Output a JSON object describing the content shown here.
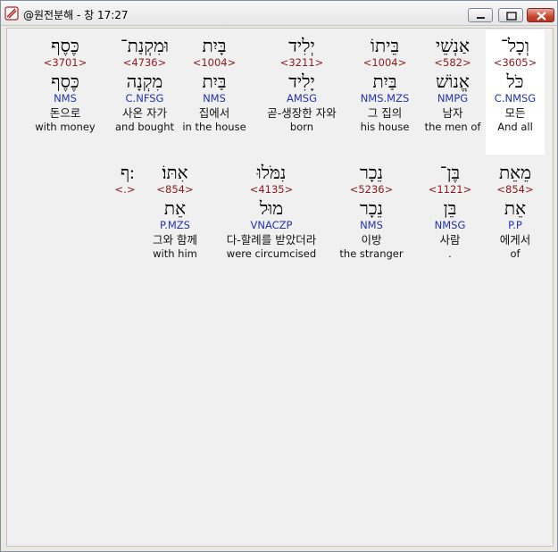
{
  "window": {
    "title": "@원전분해 - 창 17:27"
  },
  "rows": [
    {
      "words": [
        {
          "hebrew": "כֶּסֶף",
          "strong": "<3701>",
          "lemma": "כֶּסֶף",
          "morph": "NMS",
          "korean": "돈으로",
          "english": "with money"
        },
        {
          "hebrew": "וּמִקְנַת־",
          "strong": "<4736>",
          "lemma": "מִקְנָה",
          "morph": "C.NFSG",
          "korean": "사온 자가",
          "english": "and bought"
        },
        {
          "hebrew": "בָּיִת",
          "strong": "<1004>",
          "lemma": "בַּיִת",
          "morph": "NMS",
          "korean": "집에서",
          "english": "in the house"
        },
        {
          "hebrew": "יְלִיד",
          "strong": "<3211>",
          "lemma": "יָלִיד",
          "morph": "AMSG",
          "korean": "곧-생장한 자와",
          "english": "born"
        },
        {
          "hebrew": "בֵּיתוֹ",
          "strong": "<1004>",
          "lemma": "בַּיִת",
          "morph": "NMS.MZS",
          "korean": "그 집의",
          "english": "his house"
        },
        {
          "hebrew": "אַנְשֵׁי",
          "strong": "<582>",
          "lemma": "אֱנוֹשׁ",
          "morph": "NMPG",
          "korean": "남자",
          "english": "the men of"
        },
        {
          "hebrew": "וְכָל־",
          "strong": "<3605>",
          "lemma": "כֹּל",
          "morph": "C.NMSG",
          "korean": "모든",
          "english": "And all"
        }
      ]
    },
    {
      "words": [
        {
          "hebrew": "׃ף",
          "strong": "<.>",
          "lemma": "",
          "morph": "",
          "korean": "",
          "english": ""
        },
        {
          "hebrew": "אִתּוֹ׃",
          "strong": "<854>",
          "lemma": "אֵת",
          "morph": "P.MZS",
          "korean": "그와 함께",
          "english": "with him"
        },
        {
          "hebrew": "נִמֹּלוּ",
          "strong": "<4135>",
          "lemma": "מוּל",
          "morph": "VNACZP",
          "korean": "다-할례를 받았더라",
          "english": "were circumcised"
        },
        {
          "hebrew": "נֵכָר",
          "strong": "<5236>",
          "lemma": "נֵכָר",
          "morph": "NMS",
          "korean": "이방",
          "english": "the stranger"
        },
        {
          "hebrew": "בֶּן־",
          "strong": "<1121>",
          "lemma": "בֵּן",
          "morph": "NMSG",
          "korean": "사람",
          "english": "."
        },
        {
          "hebrew": "מֵאֵת",
          "strong": "<854>",
          "lemma": "אֵת",
          "morph": "P.P",
          "korean": "에게서",
          "english": "of"
        }
      ]
    }
  ]
}
